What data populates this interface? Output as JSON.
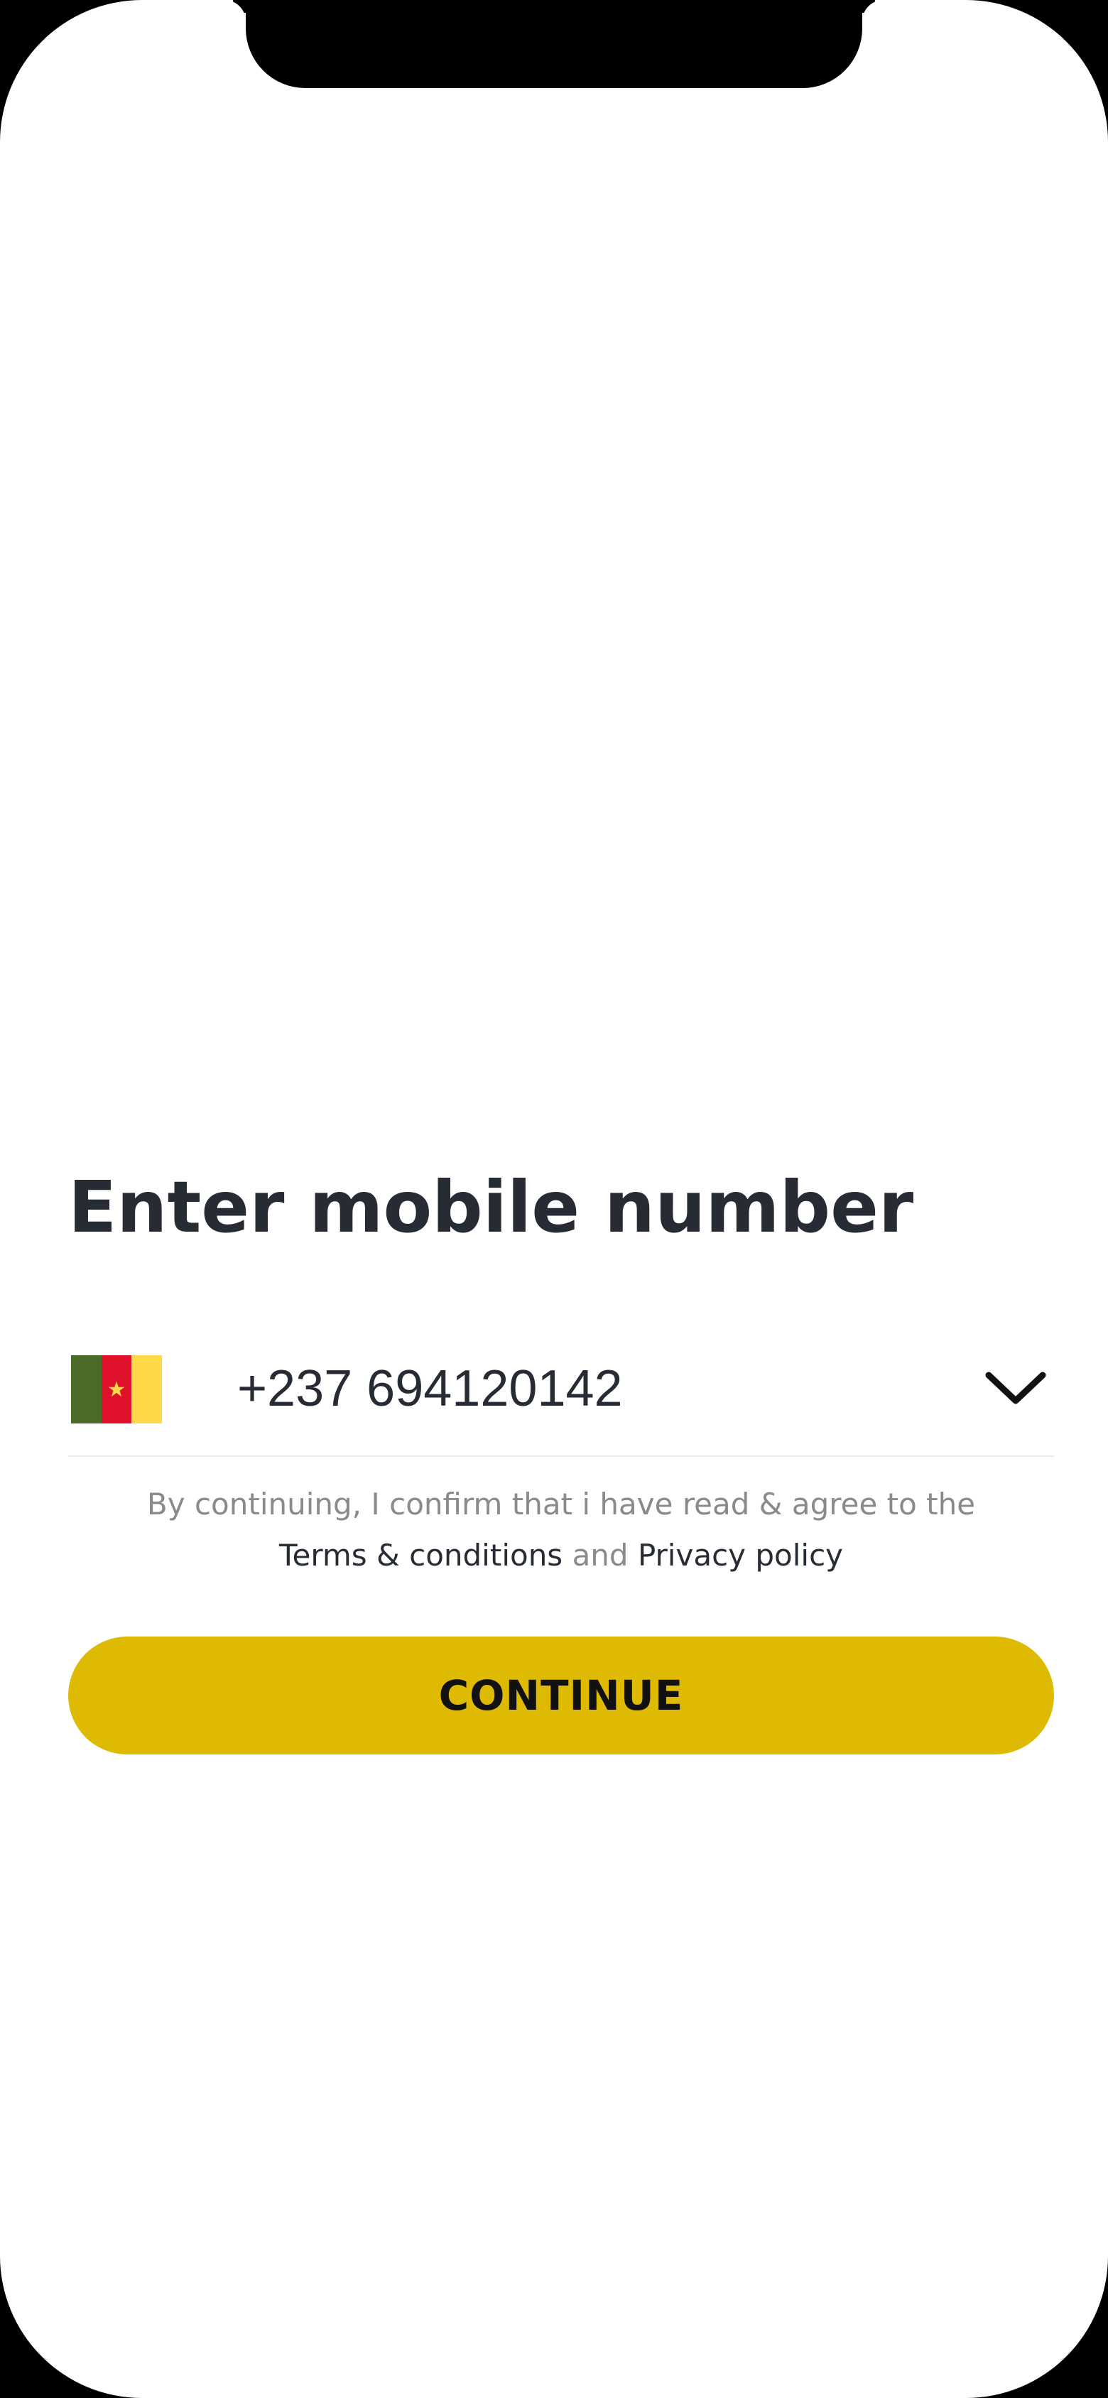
{
  "screen": {
    "title": "Enter mobile number"
  },
  "phone_input": {
    "country_flag": "cameroon-flag",
    "flag_colors": [
      "#4c6b2a",
      "#e0112b",
      "#ffd94a"
    ],
    "flag_star_color": "#ffd94a",
    "value": "+237 694120142",
    "dropdown_icon": "chevron-down-icon"
  },
  "legal": {
    "intro": "By continuing, I confirm that i have read & agree to the",
    "terms_link": "Terms & conditions",
    "conjunction": "and",
    "privacy_link": "Privacy policy"
  },
  "continue_button": {
    "label": "CONTINUE",
    "color": "#dfba03"
  }
}
